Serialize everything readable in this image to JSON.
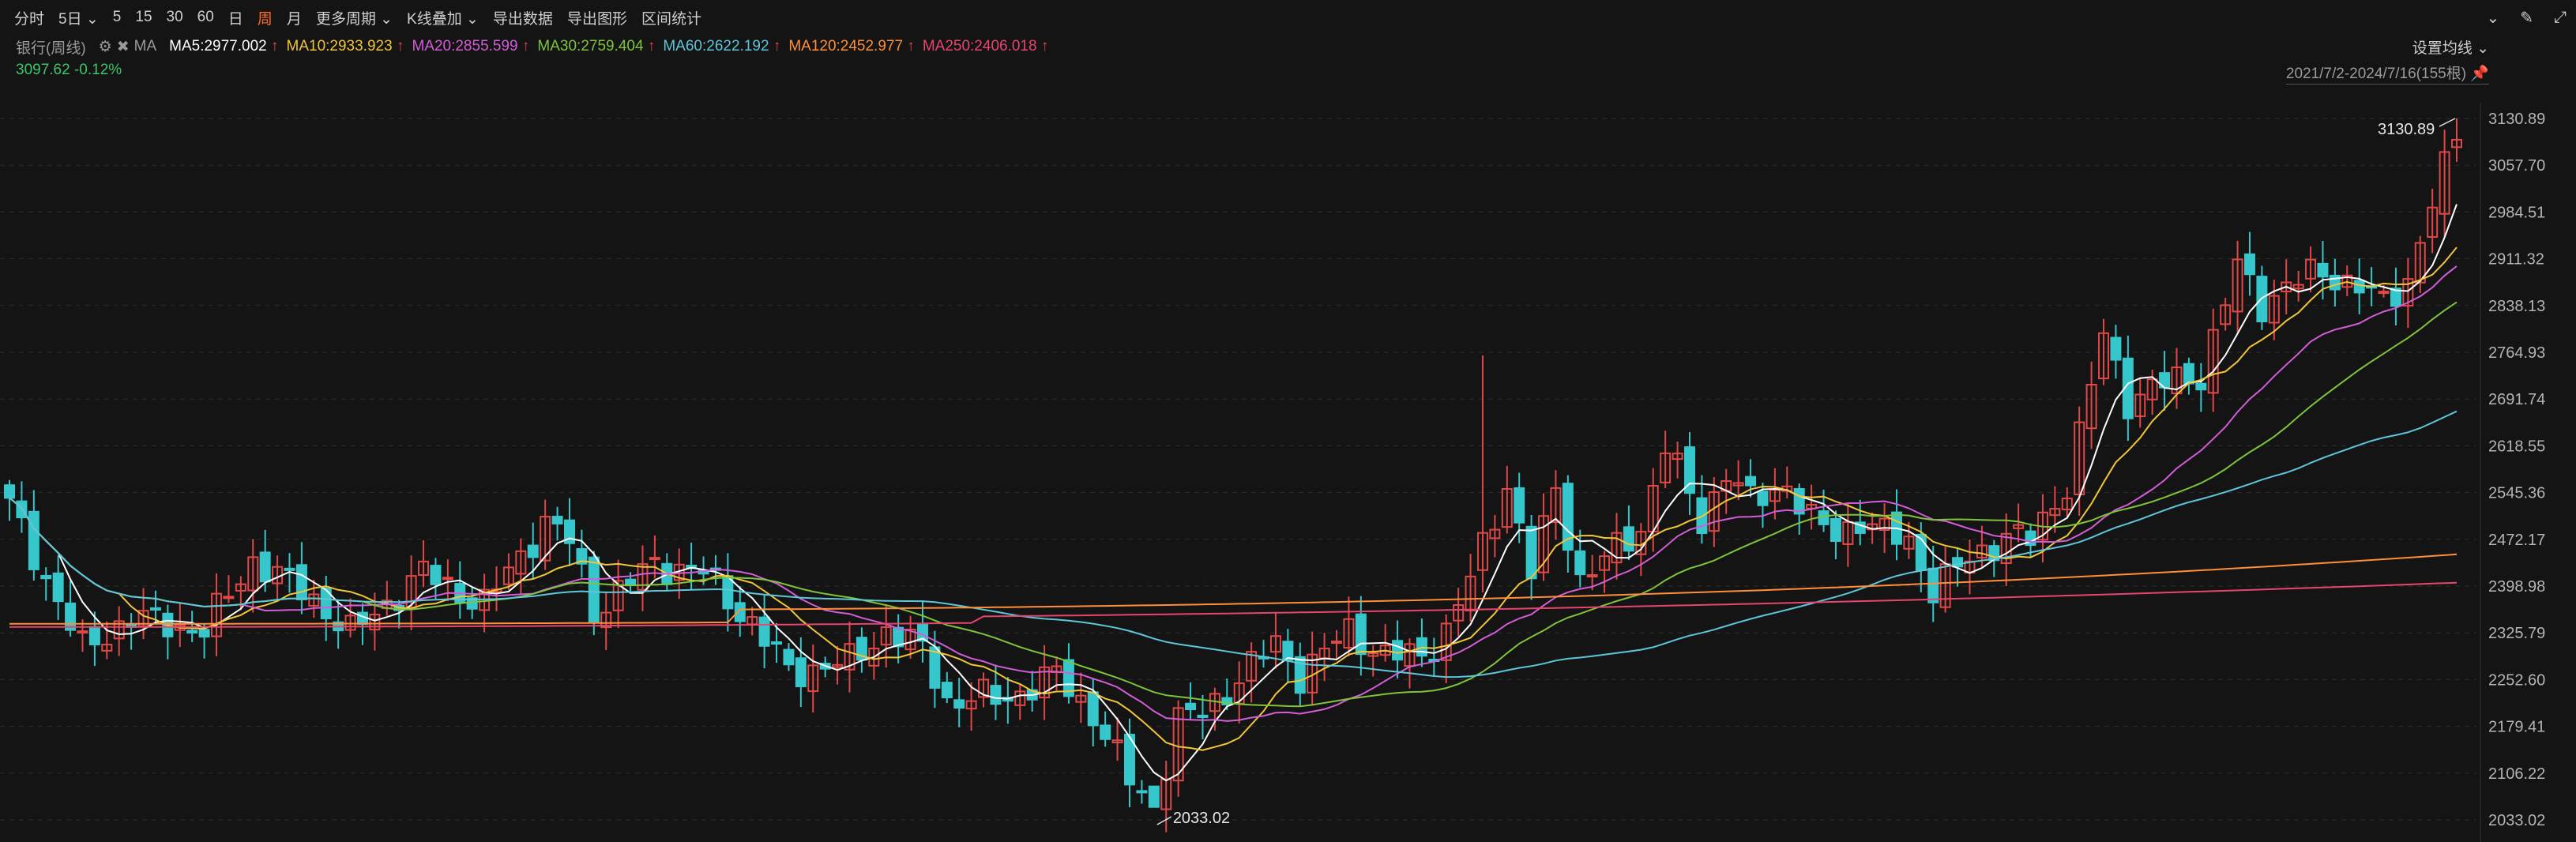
{
  "toolbar": {
    "items": [
      "分时",
      "5日",
      "5",
      "15",
      "30",
      "60",
      "日",
      "周",
      "月",
      "更多周期",
      "K线叠加",
      "导出数据",
      "导出图形",
      "区间统计"
    ],
    "active": "周",
    "dropdown_items": [
      "5日",
      "更多周期",
      "K线叠加"
    ]
  },
  "legend": {
    "name": "银行(周线)",
    "ma_label": "MA",
    "entries": [
      {
        "label": "MA5:2977.002",
        "color": "#ffffff",
        "arrow": "↑"
      },
      {
        "label": "MA10:2933.923",
        "color": "#f0c53a",
        "arrow": "↑"
      },
      {
        "label": "MA20:2855.599",
        "color": "#d35dd8",
        "arrow": "↑"
      },
      {
        "label": "MA30:2759.404",
        "color": "#7ec43b",
        "arrow": "↑"
      },
      {
        "label": "MA60:2622.192",
        "color": "#5dc6d9",
        "arrow": "↑"
      },
      {
        "label": "MA120:2452.977",
        "color": "#ff8f3a",
        "arrow": "↑"
      },
      {
        "label": "MA250:2406.018",
        "color": "#e8456e",
        "arrow": "↑"
      }
    ],
    "price": "3097.62  -0.12%"
  },
  "controls": {
    "set_ma": "设置均线",
    "range": "2021/7/2-2024/7/16(155根)"
  },
  "colors": {
    "up": "#e04848",
    "down": "#36c7cc",
    "grid": "#2c2c2c",
    "bg": "#141414"
  },
  "chart_data": {
    "type": "candlestick",
    "title": "银行(周线)",
    "ylim": [
      2033.02,
      3130.89
    ],
    "y_ticks": [
      "3130.89",
      "3057.70",
      "2984.51",
      "2911.32",
      "2838.13",
      "2764.93",
      "2691.74",
      "2618.55",
      "2545.36",
      "2472.17",
      "2398.98",
      "2325.79",
      "2252.60",
      "2179.41",
      "2106.22",
      "2033.02"
    ],
    "annotations": {
      "high": "3130.89",
      "low": "2033.02"
    },
    "anchors": [
      [
        0,
        2525
      ],
      [
        6,
        2300
      ],
      [
        10,
        2350
      ],
      [
        16,
        2330
      ],
      [
        20,
        2440
      ],
      [
        25,
        2380
      ],
      [
        28,
        2325
      ],
      [
        34,
        2420
      ],
      [
        39,
        2370
      ],
      [
        44,
        2500
      ],
      [
        46,
        2470
      ],
      [
        48,
        2360
      ],
      [
        53,
        2435
      ],
      [
        57,
        2420
      ],
      [
        61,
        2340
      ],
      [
        64,
        2265
      ],
      [
        69,
        2280
      ],
      [
        72,
        2330
      ],
      [
        75,
        2300
      ],
      [
        77,
        2220
      ],
      [
        82,
        2225
      ],
      [
        86,
        2260
      ],
      [
        89,
        2200
      ],
      [
        92,
        2095
      ],
      [
        94,
        2055
      ],
      [
        96,
        2190
      ],
      [
        98,
        2200
      ],
      [
        104,
        2310
      ],
      [
        106,
        2260
      ],
      [
        110,
        2330
      ],
      [
        113,
        2290
      ],
      [
        116,
        2290
      ],
      [
        118,
        2330
      ],
      [
        120,
        2410
      ],
      [
        123,
        2560
      ],
      [
        125,
        2420
      ],
      [
        127,
        2550
      ],
      [
        129,
        2410
      ],
      [
        131,
        2440
      ],
      [
        134,
        2490
      ],
      [
        136,
        2620
      ],
      [
        139,
        2500
      ],
      [
        141,
        2580
      ],
      [
        143,
        2530
      ],
      [
        146,
        2560
      ],
      [
        148,
        2500
      ],
      [
        150,
        2480
      ],
      [
        152,
        2505
      ],
      [
        154,
        2480
      ],
      [
        156,
        2470
      ],
      [
        158,
        2395
      ],
      [
        161,
        2440
      ],
      [
        164,
        2480
      ],
      [
        166,
        2470
      ],
      [
        169,
        2560
      ],
      [
        172,
        2790
      ],
      [
        174,
        2690
      ],
      [
        176,
        2710
      ],
      [
        180,
        2730
      ],
      [
        183,
        2900
      ],
      [
        185,
        2840
      ],
      [
        187,
        2870
      ],
      [
        190,
        2890
      ],
      [
        193,
        2870
      ],
      [
        195,
        2840
      ],
      [
        197,
        2880
      ],
      [
        199,
        3000
      ],
      [
        201,
        3098
      ]
    ]
  }
}
